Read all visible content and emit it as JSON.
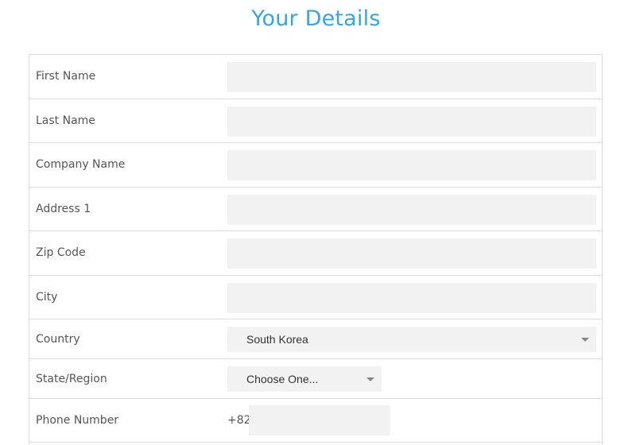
{
  "page": {
    "title": "Your Details"
  },
  "form": {
    "fields": [
      {
        "label": "First Name",
        "value": ""
      },
      {
        "label": "Last Name",
        "value": ""
      },
      {
        "label": "Company Name",
        "value": ""
      },
      {
        "label": "Address 1",
        "value": ""
      },
      {
        "label": "Zip Code",
        "value": ""
      },
      {
        "label": "City",
        "value": ""
      }
    ],
    "country": {
      "label": "Country",
      "selected": "South Korea"
    },
    "state": {
      "label": "State/Region",
      "selected": "Choose One..."
    },
    "phone": {
      "label": "Phone Number",
      "dial_code": "+82",
      "value": ""
    }
  },
  "colors": {
    "title": "#35a6e3",
    "input_bg": "#f2f2f2",
    "border": "#dcdcdc"
  }
}
